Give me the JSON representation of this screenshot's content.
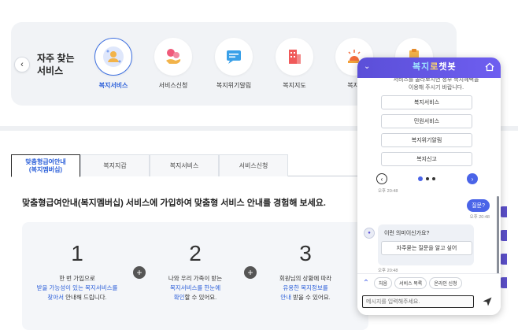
{
  "frequent": {
    "title_line1": "자주 찾는",
    "title_line2": "서비스",
    "prev_icon": "chevron-left-icon",
    "items": [
      {
        "label": "복지서비스",
        "icon": "people-icon",
        "active": true
      },
      {
        "label": "서비스신청",
        "icon": "hand-coin-icon",
        "active": false
      },
      {
        "label": "복지위기알림",
        "icon": "message-alert-icon",
        "active": false
      },
      {
        "label": "복지지도",
        "icon": "map-building-icon",
        "active": false
      },
      {
        "label": "복지-",
        "icon": "siren-icon",
        "active": false
      },
      {
        "label": "",
        "icon": "clipboard-icon",
        "active": false
      }
    ]
  },
  "tabs": [
    {
      "label_line1": "맞춤형급여안내",
      "label_line2": "(복지멤버십)",
      "active": true
    },
    {
      "label_line1": "복지지갑",
      "label_line2": "",
      "active": false
    },
    {
      "label_line1": "복지서비스",
      "label_line2": "",
      "active": false
    },
    {
      "label_line1": "서비스신청",
      "label_line2": "",
      "active": false
    }
  ],
  "headline": "맞춤형급여안내(복지멤버십) 서비스에 가입하여 맞춤형 서비스 안내를 경험해 보세요.",
  "steps": [
    {
      "num": "1",
      "l1": "한 번 가입으로",
      "l2": "받을 가능성이 있는 복지서비스를",
      "l3a": "찾아서",
      "l3b": " 안내해 드립니다."
    },
    {
      "num": "2",
      "l1": "나와 우리 가족이 받는",
      "l2": "복지서비스를 한눈에",
      "l3a": "확인",
      "l3b": "할 수 있어요."
    },
    {
      "num": "3",
      "l1": "회원님의 상황에 따라",
      "l2": "유용한 복지정보를",
      "l3a": "안내",
      "l3b": " 받을 수 있어요."
    }
  ],
  "chat": {
    "logo_part1": "복지",
    "logo_part2": "로",
    "logo_part3": "챗봇",
    "cut_text": "이용해 주시기 바랍니다.",
    "cut_text_top": "서비스를 골라보시면 정부 복지혜택을",
    "options": [
      "복지서비스",
      "민원서비스",
      "복지위기알림",
      "복지신고"
    ],
    "time1": "오후 20:48",
    "user_msg": "질문?",
    "time2": "오후 20:48",
    "bot_question": "이런 의미이신가요?",
    "bot_button": "자주묻는 질문을 알고 싶어",
    "time3": "오후 20:48",
    "chips": [
      "처음",
      "서비스 목록",
      "온라인 신청"
    ],
    "input_placeholder": "메시지를 입력해주세요.",
    "input_value": ""
  },
  "colors": {
    "primary": "#2b5fd9",
    "chat_header": "#5b4fd8",
    "accent": "#4a64e8"
  }
}
